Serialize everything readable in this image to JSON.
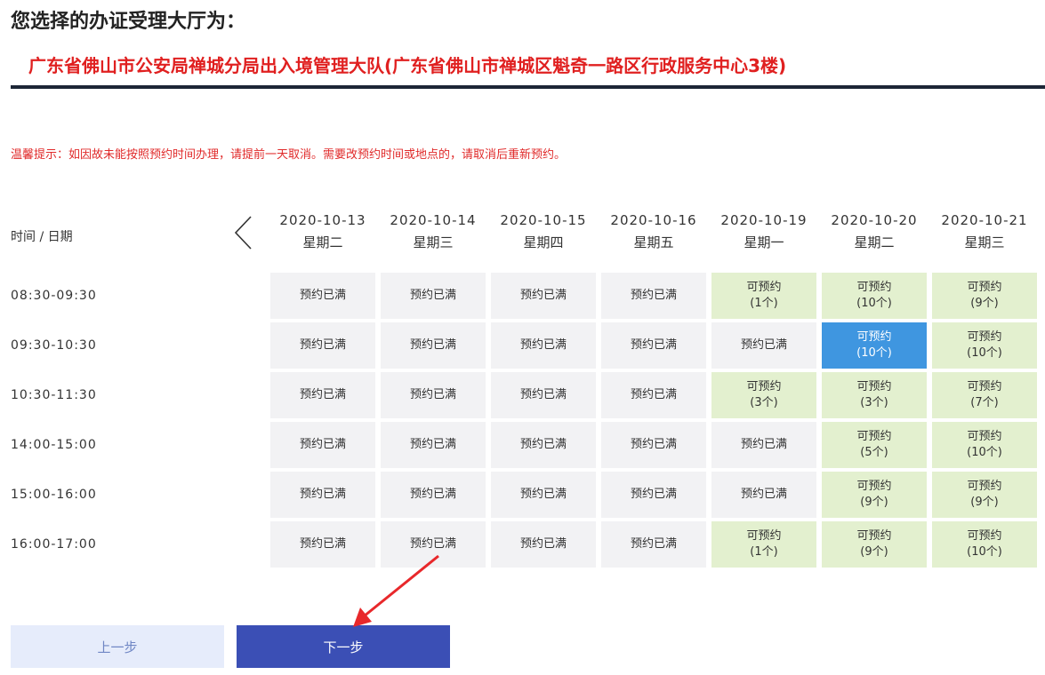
{
  "header": {
    "label": "您选择的办证受理大厅为：",
    "hall_name": "广东省佛山市公安局禅城分局出入境管理大队(广东省佛山市禅城区魁奇一路区行政服务中心3楼)"
  },
  "notice": "温馨提示：如因故未能按照预约时间办理，请提前一天取消。需要改预约时间或地点的，请取消后重新预约。",
  "schedule": {
    "corner_label": "时间 / 日期",
    "prev_icon": "chevron-left-icon",
    "dates": [
      {
        "date": "2020-10-13",
        "weekday": "星期二"
      },
      {
        "date": "2020-10-14",
        "weekday": "星期三"
      },
      {
        "date": "2020-10-15",
        "weekday": "星期四"
      },
      {
        "date": "2020-10-16",
        "weekday": "星期五"
      },
      {
        "date": "2020-10-19",
        "weekday": "星期一"
      },
      {
        "date": "2020-10-20",
        "weekday": "星期二"
      },
      {
        "date": "2020-10-21",
        "weekday": "星期三"
      }
    ],
    "full_text": "预约已满",
    "available_text": "可预约",
    "slots": [
      {
        "time": "08:30-09:30",
        "cells": [
          {
            "status": "full"
          },
          {
            "status": "full"
          },
          {
            "status": "full"
          },
          {
            "status": "full"
          },
          {
            "status": "available",
            "count": "(1个)"
          },
          {
            "status": "available",
            "count": "(10个)"
          },
          {
            "status": "available",
            "count": "(9个)"
          }
        ]
      },
      {
        "time": "09:30-10:30",
        "cells": [
          {
            "status": "full"
          },
          {
            "status": "full"
          },
          {
            "status": "full"
          },
          {
            "status": "full"
          },
          {
            "status": "full"
          },
          {
            "status": "selected",
            "count": "(10个)"
          },
          {
            "status": "available",
            "count": "(10个)"
          }
        ]
      },
      {
        "time": "10:30-11:30",
        "cells": [
          {
            "status": "full"
          },
          {
            "status": "full"
          },
          {
            "status": "full"
          },
          {
            "status": "full"
          },
          {
            "status": "available",
            "count": "(3个)"
          },
          {
            "status": "available",
            "count": "(3个)"
          },
          {
            "status": "available",
            "count": "(7个)"
          }
        ]
      },
      {
        "time": "14:00-15:00",
        "cells": [
          {
            "status": "full"
          },
          {
            "status": "full"
          },
          {
            "status": "full"
          },
          {
            "status": "full"
          },
          {
            "status": "full"
          },
          {
            "status": "available",
            "count": "(5个)"
          },
          {
            "status": "available",
            "count": "(10个)"
          }
        ]
      },
      {
        "time": "15:00-16:00",
        "cells": [
          {
            "status": "full"
          },
          {
            "status": "full"
          },
          {
            "status": "full"
          },
          {
            "status": "full"
          },
          {
            "status": "full"
          },
          {
            "status": "available",
            "count": "(9个)"
          },
          {
            "status": "available",
            "count": "(9个)"
          }
        ]
      },
      {
        "time": "16:00-17:00",
        "cells": [
          {
            "status": "full"
          },
          {
            "status": "full"
          },
          {
            "status": "full"
          },
          {
            "status": "full"
          },
          {
            "status": "available",
            "count": "(1个)"
          },
          {
            "status": "available",
            "count": "(9个)"
          },
          {
            "status": "available",
            "count": "(10个)"
          }
        ]
      }
    ]
  },
  "buttons": {
    "prev_label": "上一步",
    "next_label": "下一步"
  },
  "annotation": {
    "icon": "red-arrow-icon",
    "color": "#e8282b"
  },
  "colors": {
    "title_red": "#e02020",
    "available_bg": "#e3f0cf",
    "selected_bg": "#3f96e0",
    "full_bg": "#f2f2f4",
    "next_button_bg": "#3b4fb5",
    "prev_button_bg": "#e6ecfb"
  }
}
